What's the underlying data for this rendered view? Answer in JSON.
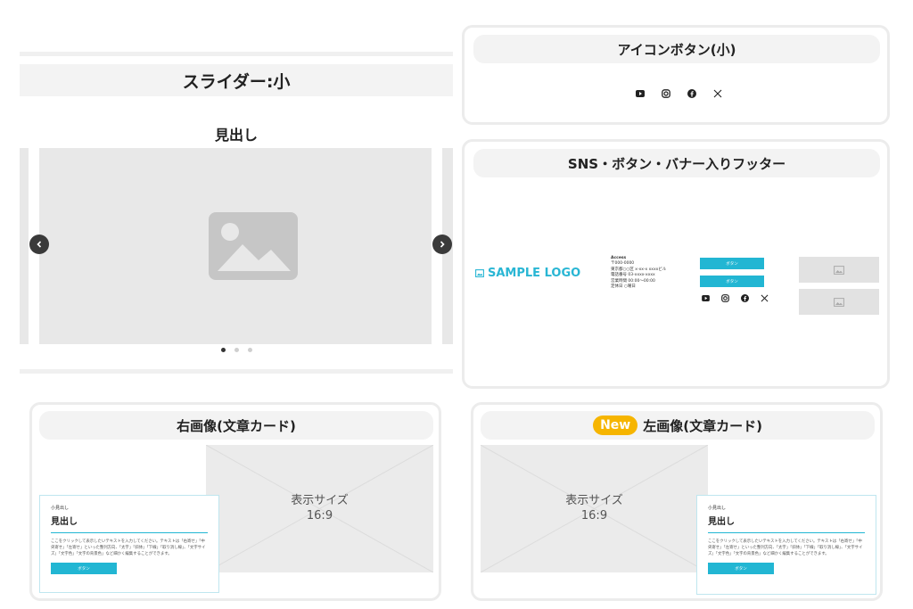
{
  "slider": {
    "title": "スライダー:小",
    "heading": "見出し",
    "dots": 3
  },
  "icon_buttons": {
    "title": "アイコンボタン(小)"
  },
  "footer": {
    "title": "SNS・ボタン・バナー入りフッター",
    "logo": "SAMPLE LOGO",
    "access_heading": "Access",
    "access_lines": [
      "〒000-0000",
      "東京都○○区 x-xx-x xxxxビル",
      "電話番号 03-xxxx-xxxx",
      "営業時間 00:00〜00:00",
      "定休日 ○曜日"
    ],
    "button1": "ボタン",
    "button2": "ボタン"
  },
  "card_right": {
    "title": "右画像(文章カード)",
    "image_label_line1": "表示サイズ",
    "image_label_line2": "16:9",
    "small": "小見出し",
    "heading": "見出し",
    "body": "ここをクリックして表示したいテキストを入力してください。テキストは「右寄せ」「中央寄せ」「左寄せ」といった整列方向、「太字」「斜体」「下線」「取り消し線」、「文字サイズ」「文字色」「文字の背景色」など細かく編集することができます。",
    "button": "ボタン"
  },
  "card_left": {
    "badge": "New",
    "title": "左画像(文章カード)",
    "image_label_line1": "表示サイズ",
    "image_label_line2": "16:9",
    "small": "小見出し",
    "heading": "見出し",
    "body": "ここをクリックして表示したいテキストを入力してください。テキストは「右寄せ」「中央寄せ」「左寄せ」といった整列方向、「太字」「斜体」「下線」「取り消し線」、「文字サイズ」「文字色」「文字の背景色」など細かく編集することができます。",
    "button": "ボタン"
  },
  "colors": {
    "accent": "#22b6d3",
    "badge": "#f6b500",
    "placeholder": "#e8e8e8"
  },
  "icons": [
    "youtube-icon",
    "instagram-icon",
    "facebook-icon",
    "x-icon",
    "image-icon",
    "chevron-left-icon",
    "chevron-right-icon"
  ]
}
